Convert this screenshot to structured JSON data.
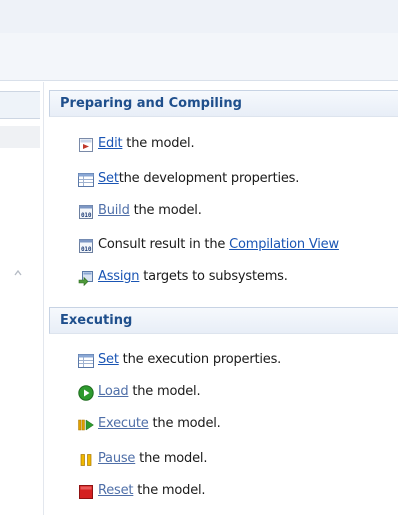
{
  "sections": {
    "prep": {
      "title": "Preparing and Compiling",
      "items": [
        {
          "icon": "edit-model-icon",
          "link": "Edit",
          "pre": "",
          "post": " the model."
        },
        {
          "icon": "properties-table-icon",
          "link": "Set",
          "pre": "",
          "post": "the development properties."
        },
        {
          "icon": "build-binary-icon",
          "link": "Build",
          "pre": "",
          "post": " the model."
        },
        {
          "icon": "build-binary-icon",
          "link": "Compilation View",
          "pre": "Consult result in the ",
          "post": ""
        },
        {
          "icon": "assign-targets-icon",
          "link": "Assign",
          "pre": "",
          "post": " targets to subsystems."
        }
      ]
    },
    "exec": {
      "title": "Executing",
      "items": [
        {
          "icon": "properties-table-icon",
          "link": "Set",
          "pre": "",
          "post": " the execution properties."
        },
        {
          "icon": "load-play-icon",
          "link": "Load",
          "pre": "",
          "post": " the model."
        },
        {
          "icon": "execute-icon",
          "link": "Execute",
          "pre": "",
          "post": " the model."
        },
        {
          "icon": "pause-icon",
          "link": "Pause",
          "pre": "",
          "post": " the model."
        },
        {
          "icon": "reset-stop-icon",
          "link": "Reset",
          "pre": "",
          "post": " the model."
        }
      ]
    }
  },
  "colors": {
    "header_text": "#1f4f8c",
    "link": "#1a55b4",
    "load_green": "#2e9a2e",
    "reset_red": "#d42020",
    "pause_amber": "#e0a000"
  }
}
